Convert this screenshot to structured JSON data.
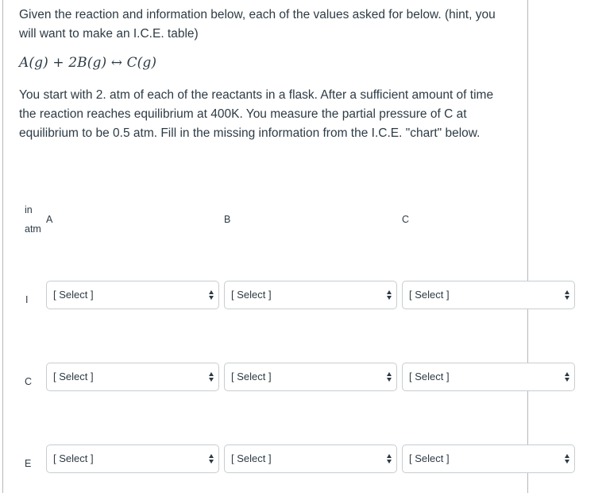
{
  "question": {
    "intro": "Given the reaction and information below, each of the values asked for below. (hint, you will want to make an I.C.E. table)",
    "equation": {
      "lhs1": "A(g)",
      "plus": "+",
      "lhs2": "2B(g)",
      "arrow": "↔",
      "rhs": "C(g)"
    },
    "details": "You start with 2. atm of each of the reactants in a flask. After a sufficient amount of time the reaction reaches equilibrium at 400K. You measure the partial pressure of C at equilibrium to be 0.5 atm. Fill in the missing information from the I.C.E. \"chart\" below."
  },
  "ice_table": {
    "unit_label_line1": "in",
    "unit_label_line2": "atm",
    "columns": [
      "A",
      "B",
      "C"
    ],
    "rows": [
      {
        "label": "I",
        "selects": [
          "[ Select ]",
          "[ Select ]",
          "[ Select ]"
        ]
      },
      {
        "label": "C",
        "selects": [
          "[ Select ]",
          "[ Select ]",
          "[ Select ]"
        ]
      },
      {
        "label": "E",
        "selects": [
          "[ Select ]",
          "[ Select ]",
          "[ Select ]"
        ]
      }
    ]
  }
}
